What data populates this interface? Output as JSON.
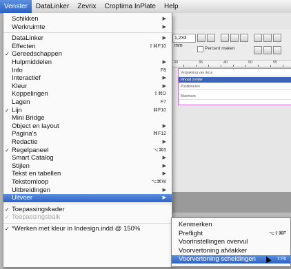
{
  "menubar": [
    "Venster",
    "DataLinker",
    "Zevrix",
    "Croptima InPlate",
    "Help"
  ],
  "docwin": {
    "size_field": "1,233 mm",
    "option_label": "Percent maken",
    "ruler_numbers": [
      "30",
      "35",
      "40",
      "50",
      "55"
    ],
    "page_rows": [
      "Verpakking van deze",
      "Positioneren",
      "Inhoud zonder",
      "Maximum"
    ]
  },
  "menu": [
    {
      "label": "Schikken",
      "arrow": true
    },
    {
      "label": "Werkruimte",
      "arrow": true
    },
    {
      "sep": true
    },
    {
      "label": "DataLinker",
      "arrow": true
    },
    {
      "label": "Effecten",
      "sc": "⇧⌘F10"
    },
    {
      "label": "Gereedschappen",
      "check": "✓"
    },
    {
      "label": "Hulpmiddelen",
      "arrow": true
    },
    {
      "label": "Info",
      "sc": "F8"
    },
    {
      "label": "Interactief",
      "arrow": true
    },
    {
      "label": "Kleur",
      "arrow": true
    },
    {
      "label": "Koppelingen",
      "sc": "⇧⌘D"
    },
    {
      "label": "Lagen",
      "sc": "F7"
    },
    {
      "label": "Lijn",
      "check": "✓",
      "sc": "⌘F10"
    },
    {
      "label": "Mini Bridge"
    },
    {
      "label": "Object en layout",
      "arrow": true
    },
    {
      "label": "Pagina's",
      "sc": "⌘F12"
    },
    {
      "label": "Redactie",
      "arrow": true
    },
    {
      "label": "Regelpaneel",
      "check": "✓",
      "sc": "⌥⌘6"
    },
    {
      "label": "Smart Catalog",
      "arrow": true
    },
    {
      "label": "Stijlen",
      "arrow": true
    },
    {
      "label": "Tekst en tabellen",
      "arrow": true
    },
    {
      "label": "Tekstomloop",
      "sc": "⌥⌘W"
    },
    {
      "label": "Uitbreidingen",
      "arrow": true
    },
    {
      "label": "Uitvoer",
      "arrow": true,
      "hl": true
    },
    {
      "sep": true
    },
    {
      "label": "Toepassingskader",
      "check": "✓"
    },
    {
      "label": "Toepassingsbalk",
      "check": "✓",
      "dis": true
    },
    {
      "sep": true
    },
    {
      "label": "*Werken met kleur in Indesign.indd @ 150%",
      "check": "✓"
    }
  ],
  "submenu": [
    {
      "label": "Kenmerken"
    },
    {
      "label": "Preflight",
      "sc": "⌥⇧⌘F"
    },
    {
      "label": "Voorinstellingen overvul"
    },
    {
      "label": "Voorvertoning afvlakker"
    },
    {
      "label": "Voorvertoning scheidingen",
      "sc": "⇧F6",
      "hl": true
    }
  ]
}
